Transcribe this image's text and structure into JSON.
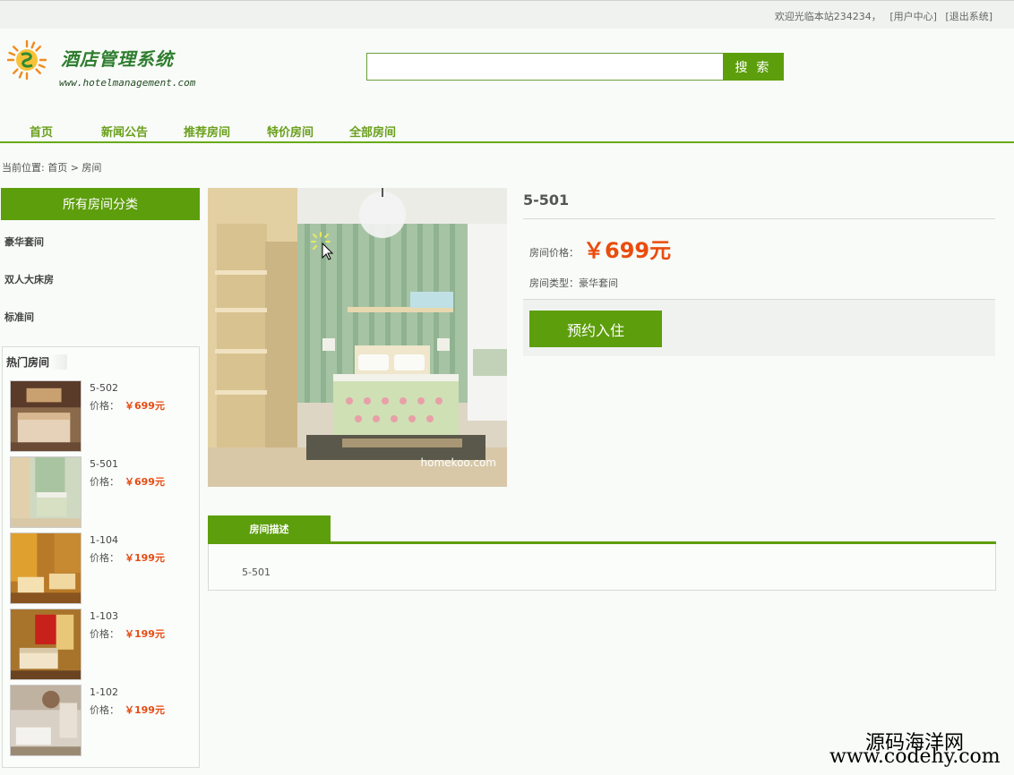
{
  "topbar": {
    "welcome": "欢迎光临本站234234，",
    "user_center": "[用户中心]",
    "logout": "[退出系统]"
  },
  "brand": {
    "title": "酒店管理系统",
    "url": "www.hotelmanagement.com"
  },
  "search": {
    "value": "",
    "button": "搜 索"
  },
  "nav": [
    "首页",
    "新闻公告",
    "推荐房间",
    "特价房间",
    "全部房间"
  ],
  "breadcrumb": "当前位置: 首页 > 房间",
  "categories": {
    "header": "所有房间分类",
    "items": [
      "豪华套间",
      "双人大床房",
      "标准间"
    ]
  },
  "hot": {
    "title": "热门房间",
    "price_label": "价格：",
    "rooms": [
      {
        "name": "5-502",
        "price": "￥699元"
      },
      {
        "name": "5-501",
        "price": "￥699元"
      },
      {
        "name": "1-104",
        "price": "￥199元"
      },
      {
        "name": "1-103",
        "price": "￥199元"
      },
      {
        "name": "1-102",
        "price": "￥199元"
      }
    ]
  },
  "detail": {
    "image_watermark": "homekoo.com",
    "name": "5-501",
    "price_label": "房间价格：",
    "price": "￥699元",
    "type_label": "房间类型：豪华套间",
    "book_button": "预约入住"
  },
  "tabs": {
    "description_tab": "房间描述",
    "description_text": "5-501"
  },
  "site_watermark": {
    "line1": "源码海洋网",
    "line2": "www.codehy.com"
  },
  "colors": {
    "accent_green": "#5d9e0c",
    "price_red": "#ea4c0e"
  }
}
